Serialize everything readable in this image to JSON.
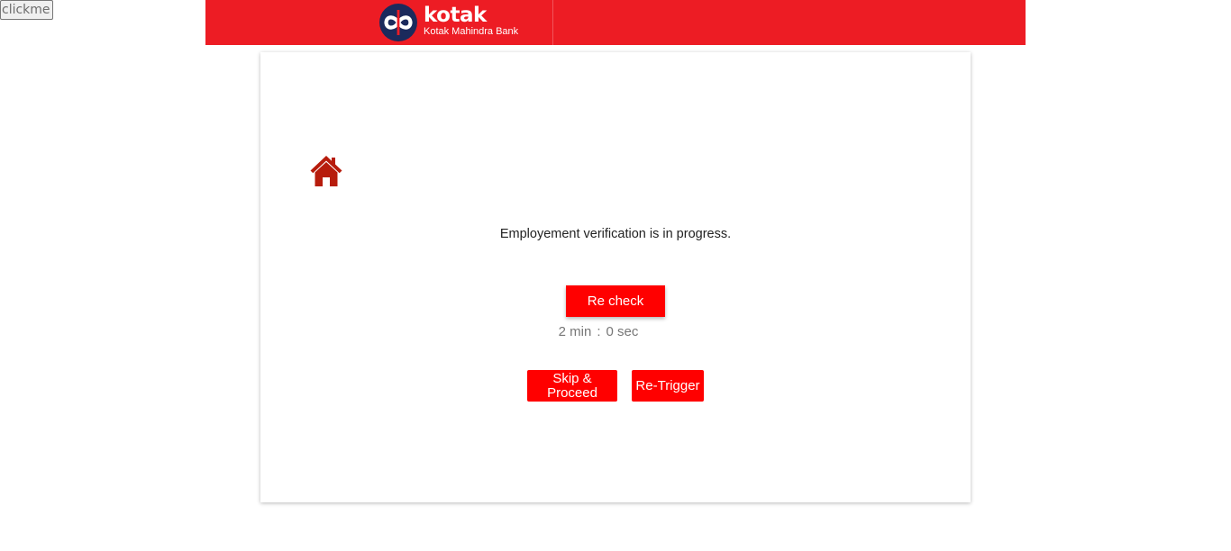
{
  "clickme_label": "clickme",
  "header": {
    "brand_name": "kotak",
    "brand_subtitle": "Kotak Mahindra Bank",
    "logo_icon": "kotak-infinity-logo",
    "background_color": "#ed1c24"
  },
  "card": {
    "home_icon": "home-icon",
    "home_icon_color": "#b71c0c",
    "status_message": "Employement verification is in progress.",
    "recheck_label": "Re check",
    "timer": {
      "minutes": "2",
      "minutes_unit": "min",
      "separator": ":",
      "seconds": "0",
      "seconds_unit": "sec"
    },
    "skip_label": "Skip & Proceed",
    "retrigger_label": "Re-Trigger",
    "button_color": "#ff0000"
  }
}
